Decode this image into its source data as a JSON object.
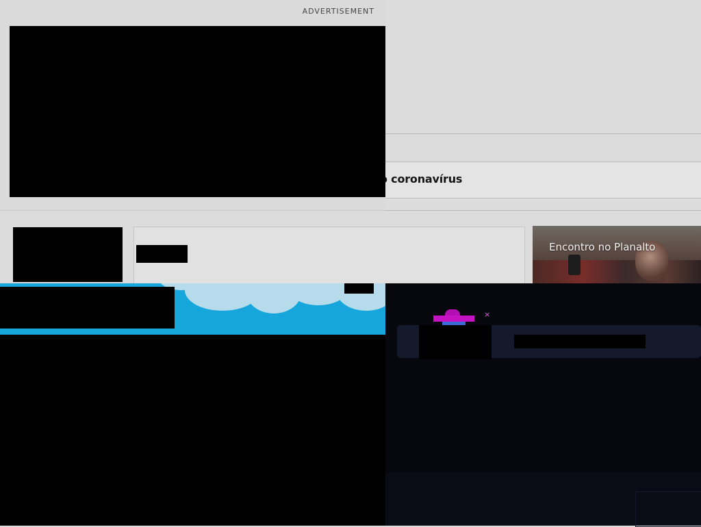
{
  "ad": {
    "label": "ADVERTISEMENT"
  },
  "nav": {
    "visible_text": "o coronavírus"
  },
  "story_card": {
    "title": "Encontro no Planalto"
  },
  "widget": {
    "close_symbol": "×"
  },
  "colors": {
    "page_background": "#dcdcdc",
    "sky_banner": "#17a6db",
    "widget_bar": "#141a2b",
    "magenta_accent": "#c513c3"
  }
}
